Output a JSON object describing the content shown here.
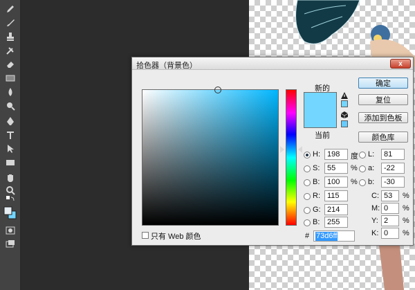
{
  "toolbar": {
    "tools": [
      "pencil-icon",
      "brush-icon",
      "stamp-icon",
      "history-brush-icon",
      "eraser-icon",
      "gradient-icon",
      "blur-icon",
      "dodge-icon",
      "pen-icon",
      "type-icon",
      "path-select-icon",
      "rectangle-icon",
      "hand-icon",
      "zoom-icon",
      "swap-colors-icon",
      "color-swatches-icon",
      "quick-mask-icon",
      "screen-mode-icon"
    ]
  },
  "dialog": {
    "title": "拾色器（背景色）",
    "close_label": "x",
    "new_label": "新的",
    "current_label": "当前",
    "new_color": "#73d6ff",
    "current_color": "#73d6ff",
    "buttons": {
      "ok": "确定",
      "reset": "复位",
      "add_to_swatches": "添加到色板",
      "color_libraries": "颜色库"
    },
    "hsb": {
      "h": {
        "label": "H:",
        "value": "198",
        "unit": "度"
      },
      "s": {
        "label": "S:",
        "value": "55",
        "unit": "%"
      },
      "b": {
        "label": "B:",
        "value": "100",
        "unit": "%"
      }
    },
    "rgb": {
      "r": {
        "label": "R:",
        "value": "115"
      },
      "g": {
        "label": "G:",
        "value": "214"
      },
      "b": {
        "label": "B:",
        "value": "255"
      }
    },
    "lab": {
      "l": {
        "label": "L:",
        "value": "81"
      },
      "a": {
        "label": "a:",
        "value": "-22"
      },
      "b": {
        "label": "b:",
        "value": "-30"
      }
    },
    "cmyk": {
      "c": {
        "label": "C:",
        "value": "53",
        "unit": "%"
      },
      "m": {
        "label": "M:",
        "value": "0",
        "unit": "%"
      },
      "y": {
        "label": "Y:",
        "value": "2",
        "unit": "%"
      },
      "k": {
        "label": "K:",
        "value": "0",
        "unit": "%"
      }
    },
    "hex_label": "#",
    "hex_value": "73d6ff",
    "web_only_label": "只有 Web 颜色"
  }
}
